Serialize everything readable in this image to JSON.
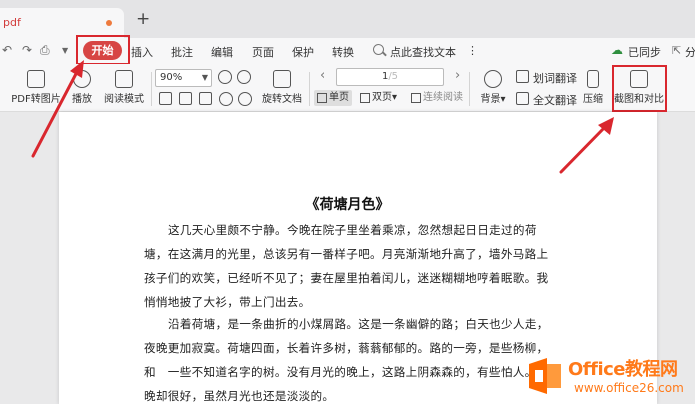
{
  "tabbar": {
    "doc_tab_title": "pdf",
    "new_tab_symbol": "+"
  },
  "menu": {
    "items": [
      "开始",
      "插入",
      "批注",
      "编辑",
      "页面",
      "保护",
      "转换"
    ],
    "search_label": "点此查找文本",
    "search_more": "⋮",
    "sync_label": "已同步",
    "share_label": "分"
  },
  "toolbar": {
    "pdf_to_image": "PDF转图片",
    "play": "播放",
    "read_mode": "阅读模式",
    "zoom_value": "90%",
    "rotate_doc": "旋转文档",
    "page_current": "1",
    "page_total": "/5",
    "single_page": "单页",
    "double_page": "双页",
    "continuous_read": "连续阅读",
    "background": "背景",
    "word_translate": "划词翻译",
    "full_translate": "全文翻译",
    "compress": "压缩",
    "screenshot_compare": "截图和对比"
  },
  "document": {
    "title": "《荷塘月色》",
    "paragraphs": [
      "这几天心里颇不宁静。今晚在院子里坐着乘凉，忽然想起日日走过的荷塘，在这满月的光里，总该另有一番样子吧。月亮渐渐地升高了，墙外马路上孩子们的欢笑，已经听不见了；妻在屋里拍着闰儿，迷迷糊糊地哼着眠歌。我悄悄地披了大衫，带上门出去。",
      "沿着荷塘，是一条曲折的小煤屑路。这是一条幽僻的路；白天也少人走，夜晚更加寂寞。荷塘四面，长着许多树，蓊蓊郁郁的。路的一旁，是些杨柳，和　一些不知道名字的树。没有月光的晚上，这路上阴森森的，有些怕人。今晚却很好，虽然月光也还是淡淡的。"
    ]
  },
  "watermark": {
    "brand": "Office教程网",
    "url": "www.office26.com"
  },
  "colors": {
    "accent": "#d74544",
    "highlight_box": "#d9272e",
    "watermark": "#ff7a1a"
  }
}
